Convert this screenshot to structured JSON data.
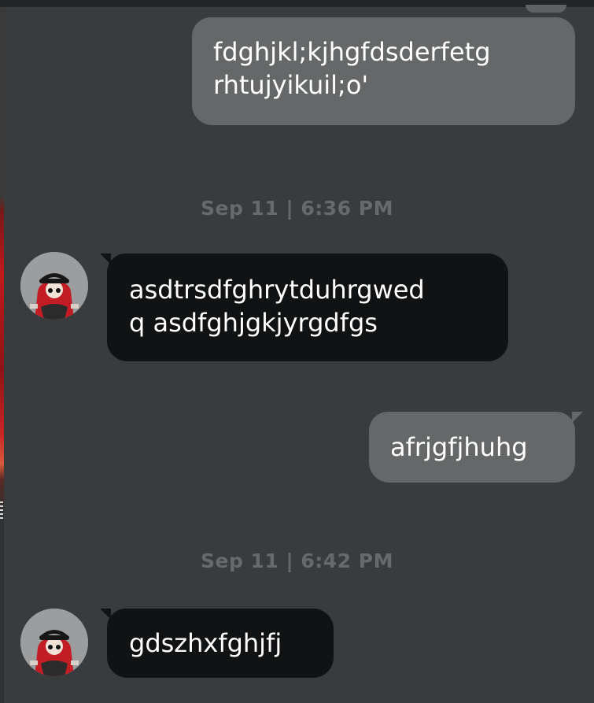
{
  "messages": [
    {
      "direction": "outgoing",
      "lines": [
        "fdghjkl;kjhgfdsderfetg",
        "rhtujyikuil;o'"
      ]
    },
    {
      "timestamp": "Sep 11 | 6:36 PM"
    },
    {
      "direction": "incoming",
      "lines": [
        "asdtrsdfghrytduhrgwed",
        "q asdfghjgkjyrgdfgs"
      ]
    },
    {
      "direction": "outgoing",
      "lines": [
        "afrjgfjhuhg"
      ]
    },
    {
      "timestamp": "Sep 11 | 6:42 PM"
    },
    {
      "direction": "incoming",
      "lines": [
        "gdszhxfghjfj"
      ]
    }
  ],
  "colors": {
    "background": "#393b3d",
    "outgoing_bubble": "#656768",
    "incoming_bubble": "#111214",
    "timestamp_text": "#676a6d",
    "message_text": "#ffffff"
  },
  "icons": {
    "contact_avatar": "avatar-red-hair-black-cap"
  }
}
